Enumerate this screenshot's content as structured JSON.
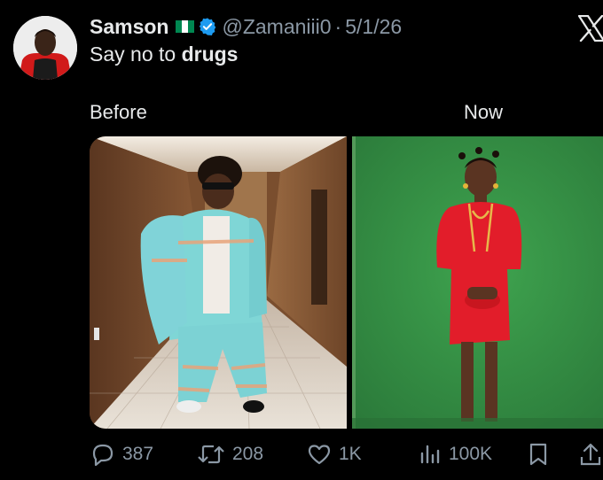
{
  "post": {
    "author_name": "Samson",
    "handle": "@Zamaniii0",
    "separator": "·",
    "date": "5/1/26",
    "text_plain": "Say no to ",
    "text_bold": "drugs"
  },
  "media": {
    "left_label": "Before",
    "right_label": "Now"
  },
  "actions": {
    "replies": "387",
    "reposts": "208",
    "likes": "1K",
    "views": "100K"
  },
  "icons": {
    "reply": "reply-icon",
    "repost": "repost-icon",
    "like": "heart-icon",
    "views": "views-icon",
    "bookmark": "bookmark-icon",
    "share": "share-icon",
    "verified": "verified-badge-icon",
    "flag": "nigeria-flag-icon",
    "brand": "x-logo-icon"
  },
  "colors": {
    "background": "#000000",
    "text": "#e7e9ea",
    "muted": "#8b98a5",
    "verified": "#1d9bf0",
    "flag_green": "#008751"
  }
}
